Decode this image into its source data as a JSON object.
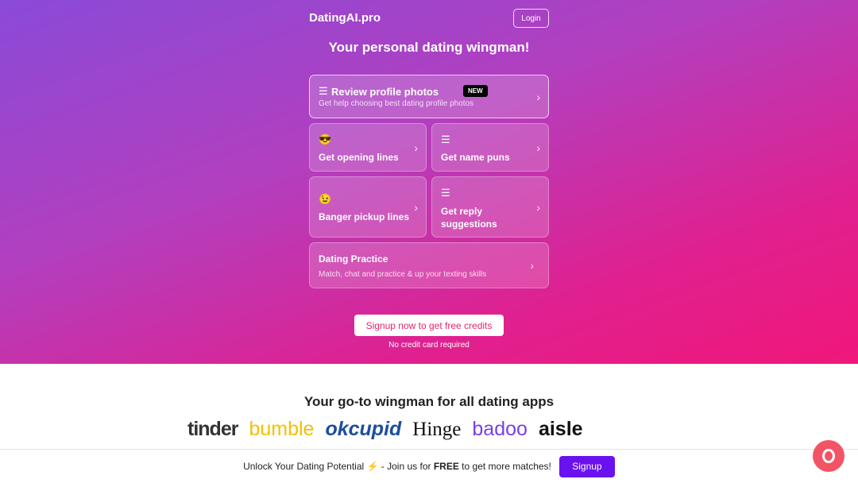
{
  "header": {
    "brand": "DatingAI.pro",
    "login": "Login"
  },
  "tagline": "Your personal dating wingman!",
  "cards": [
    {
      "title": "Review profile photos",
      "subtitle": "Get help choosing best dating profile photos",
      "badge": "NEW",
      "icon": "bars-icon"
    },
    {
      "title": "Get opening lines",
      "icon": "cool-smiley-icon"
    },
    {
      "title": "Get name puns",
      "icon": "bars-icon"
    },
    {
      "title": "Banger pickup lines",
      "icon": "wink-smiley-icon"
    },
    {
      "title": "Get reply suggestions",
      "icon": "bars-icon"
    },
    {
      "title": "Dating Practice",
      "subtitle": "Match, chat and practice & up your texting skills"
    }
  ],
  "cta": {
    "label": "Signup now to get free credits",
    "note": "No credit card required"
  },
  "apps": {
    "title": "Your go-to wingman for all dating apps",
    "logos": [
      "tinder",
      "bumble",
      "okcupid",
      "Hinge",
      "badoo",
      "aisle"
    ]
  },
  "banner": {
    "pre": "Unlock Your Dating Potential ⚡ - Join us for ",
    "bold": "FREE",
    "post": " to get more matches!",
    "button": "Signup"
  },
  "colors": {
    "accent": "#6a11f0",
    "cta_text": "#e6246f",
    "chat": "#f25466"
  }
}
